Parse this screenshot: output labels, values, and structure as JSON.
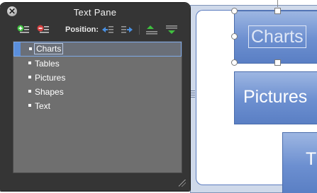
{
  "pane": {
    "title": "Text Pane",
    "close_glyph": "✕",
    "toolbar": {
      "position_label": "Position:",
      "buttons": [
        {
          "name": "add-bullet-icon",
          "color": "#3fbf3f"
        },
        {
          "name": "remove-bullet-icon",
          "color": "#d64040"
        },
        {
          "name": "promote-icon",
          "color": "#4a90e2"
        },
        {
          "name": "demote-icon",
          "color": "#4a90e2"
        },
        {
          "name": "move-up-icon",
          "color": "#3fbf3f"
        },
        {
          "name": "move-down-icon",
          "color": "#3fbf3f"
        }
      ]
    },
    "items": [
      {
        "label": "Charts",
        "selected": true
      },
      {
        "label": "Tables",
        "selected": false
      },
      {
        "label": "Pictures",
        "selected": false
      },
      {
        "label": "Shapes",
        "selected": false
      },
      {
        "label": "Text",
        "selected": false
      }
    ]
  },
  "canvas": {
    "shapes": {
      "charts": "Charts",
      "pictures": "Pictures",
      "text": "T"
    }
  },
  "colors": {
    "pane_bg": "#262626",
    "list_bg": "#6f6f6f",
    "selection_accent": "#5b8fdc",
    "shape_fill": "#6c8fd0"
  }
}
